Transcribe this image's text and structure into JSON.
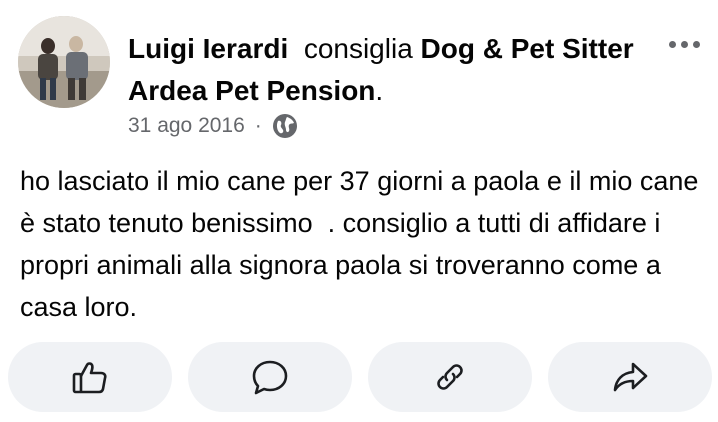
{
  "post": {
    "author": "Luigi Ierardi",
    "verb": "consiglia",
    "page_name": "Dog & Pet Sitter Ardea Pet Pension",
    "period": ".",
    "date": "31 ago 2016",
    "separator": "·",
    "privacy_icon": "globe-icon",
    "body": "ho lasciato il mio cane per 37 giorni a paola e il mio cane è stato tenuto benissimo  . consiglio a tutti di affidare i propri animali alla signora paola si troveranno come a casa loro."
  },
  "actions": [
    {
      "name": "like",
      "icon": "thumbs-up-icon"
    },
    {
      "name": "comment",
      "icon": "speech-bubble-icon"
    },
    {
      "name": "copy-link",
      "icon": "link-icon"
    },
    {
      "name": "share",
      "icon": "share-arrow-icon"
    }
  ],
  "colors": {
    "text_primary": "#050505",
    "text_secondary": "#65676b",
    "button_bg": "#f0f2f5"
  }
}
